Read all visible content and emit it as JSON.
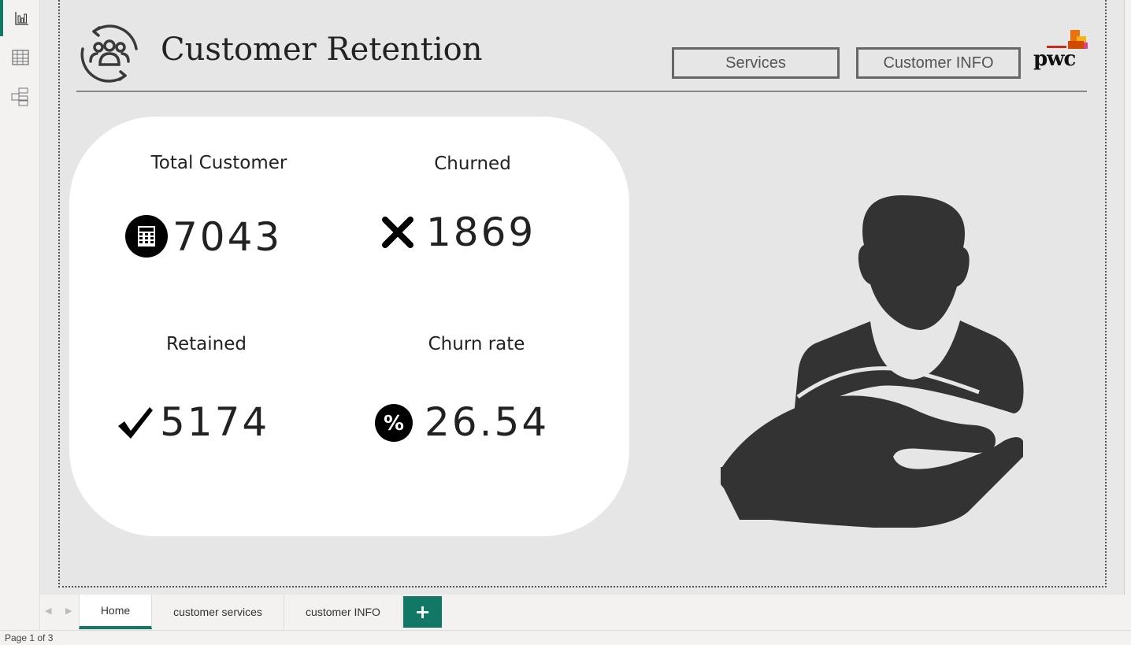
{
  "sidebar": {
    "items": [
      {
        "icon": "report-view-icon",
        "active": true
      },
      {
        "icon": "table-view-icon"
      },
      {
        "icon": "model-view-icon"
      }
    ]
  },
  "header": {
    "title": "Customer Retention",
    "buttons": {
      "services": "Services",
      "customer_info": "Customer INFO"
    },
    "logo": "pwc"
  },
  "kpis": {
    "total_customer": {
      "label": "Total Customer",
      "value": "7043",
      "icon": "calculator-icon"
    },
    "churned": {
      "label": "Churned",
      "value": "1869",
      "icon": "x-icon"
    },
    "retained": {
      "label": "Retained",
      "value": "5174",
      "icon": "checkmark-icon"
    },
    "churn_rate": {
      "label": "Churn rate",
      "value": "26.54",
      "icon": "percent-icon"
    }
  },
  "tabs": [
    {
      "label": "Home",
      "active": true
    },
    {
      "label": "customer services"
    },
    {
      "label": "customer INFO"
    }
  ],
  "add_tab": "+",
  "status": "Page 1 of 3",
  "colors": {
    "accent": "#117865",
    "icon_dark": "#333333"
  }
}
